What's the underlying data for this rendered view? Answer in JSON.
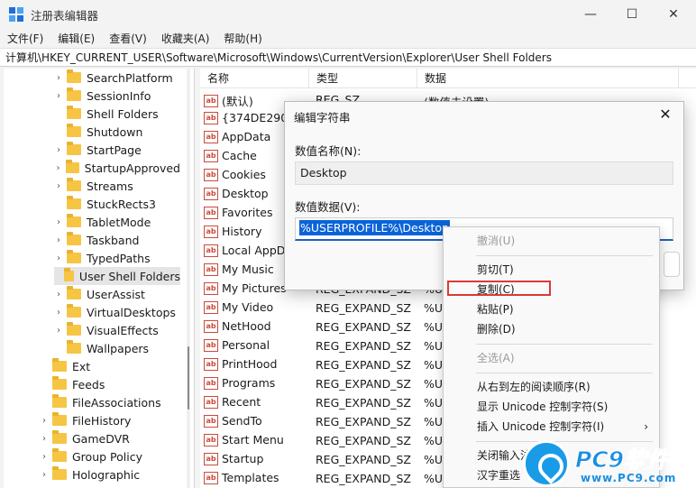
{
  "window": {
    "title": "注册表编辑器",
    "minimize": "—",
    "maximize": "☐",
    "close": "✕"
  },
  "menubar": [
    "文件(F)",
    "编辑(E)",
    "查看(V)",
    "收藏夹(A)",
    "帮助(H)"
  ],
  "address": "计算机\\HKEY_CURRENT_USER\\Software\\Microsoft\\Windows\\CurrentVersion\\Explorer\\User Shell Folders",
  "tree": [
    {
      "label": "SearchPlatform",
      "chevron": "›"
    },
    {
      "label": "SessionInfo",
      "chevron": "›"
    },
    {
      "label": "Shell Folders",
      "chevron": ""
    },
    {
      "label": "Shutdown",
      "chevron": ""
    },
    {
      "label": "StartPage",
      "chevron": "›"
    },
    {
      "label": "StartupApproved",
      "chevron": "›"
    },
    {
      "label": "Streams",
      "chevron": "›"
    },
    {
      "label": "StuckRects3",
      "chevron": ""
    },
    {
      "label": "TabletMode",
      "chevron": "›"
    },
    {
      "label": "Taskband",
      "chevron": "›"
    },
    {
      "label": "TypedPaths",
      "chevron": "›"
    },
    {
      "label": "User Shell Folders",
      "chevron": "",
      "selected": true
    },
    {
      "label": "UserAssist",
      "chevron": "›"
    },
    {
      "label": "VirtualDesktops",
      "chevron": "›"
    },
    {
      "label": "VisualEffects",
      "chevron": "›"
    },
    {
      "label": "Wallpapers",
      "chevron": ""
    },
    {
      "label": "Ext",
      "chevron": ""
    },
    {
      "label": "Feeds",
      "chevron": ""
    },
    {
      "label": "FileAssociations",
      "chevron": ""
    },
    {
      "label": "FileHistory",
      "chevron": "›"
    },
    {
      "label": "GameDVR",
      "chevron": "›"
    },
    {
      "label": "Group Policy",
      "chevron": "›"
    },
    {
      "label": "Holographic",
      "chevron": "›"
    }
  ],
  "columns": {
    "name": "名称",
    "type": "类型",
    "data": "数据"
  },
  "rows": [
    {
      "name": "(默认)",
      "type": "REG_SZ",
      "data": "(数值未设置)"
    },
    {
      "name": "{374DE290-",
      "type": "",
      "data": ""
    },
    {
      "name": "AppData",
      "type": "",
      "data": ""
    },
    {
      "name": "Cache",
      "type": "",
      "data": ""
    },
    {
      "name": "Cookies",
      "type": "",
      "data": ""
    },
    {
      "name": "Desktop",
      "type": "",
      "data": ""
    },
    {
      "name": "Favorites",
      "type": "",
      "data": ""
    },
    {
      "name": "History",
      "type": "",
      "data": ""
    },
    {
      "name": "Local AppD",
      "type": "",
      "data": ""
    },
    {
      "name": "My Music",
      "type": "",
      "data": ""
    },
    {
      "name": "My Pictures",
      "type": "REG_EXPAND_SZ",
      "data": "%U"
    },
    {
      "name": "My Video",
      "type": "REG_EXPAND_SZ",
      "data": "%U"
    },
    {
      "name": "NetHood",
      "type": "REG_EXPAND_SZ",
      "data": "%U"
    },
    {
      "name": "Personal",
      "type": "REG_EXPAND_SZ",
      "data": "%U"
    },
    {
      "name": "PrintHood",
      "type": "REG_EXPAND_SZ",
      "data": "%U"
    },
    {
      "name": "Programs",
      "type": "REG_EXPAND_SZ",
      "data": "%U"
    },
    {
      "name": "Recent",
      "type": "REG_EXPAND_SZ",
      "data": "%U"
    },
    {
      "name": "SendTo",
      "type": "REG_EXPAND_SZ",
      "data": "%U"
    },
    {
      "name": "Start Menu",
      "type": "REG_EXPAND_SZ",
      "data": "%U"
    },
    {
      "name": "Startup",
      "type": "REG_EXPAND_SZ",
      "data": "%U"
    },
    {
      "name": "Templates",
      "type": "REG_EXPAND_SZ",
      "data": "%U"
    }
  ],
  "dialog": {
    "title": "编辑字符串",
    "close": "✕",
    "name_label": "数值名称(N):",
    "name_value": "Desktop",
    "data_label": "数值数据(V):",
    "data_value": "%USERPROFILE%\\Desktop"
  },
  "context_menu": [
    {
      "label": "撤消(U)",
      "disabled": true
    },
    {
      "separator": true
    },
    {
      "label": "剪切(T)"
    },
    {
      "label": "复制(C)"
    },
    {
      "label": "粘贴(P)"
    },
    {
      "label": "删除(D)"
    },
    {
      "separator": true
    },
    {
      "label": "全选(A)",
      "disabled": true
    },
    {
      "separator": true
    },
    {
      "label": "从右到左的阅读顺序(R)"
    },
    {
      "label": "显示 Unicode 控制字符(S)"
    },
    {
      "label": "插入 Unicode 控制字符(I)",
      "submenu": "›"
    },
    {
      "separator": true
    },
    {
      "label": "关闭输入法"
    },
    {
      "label": "汉字重选"
    }
  ],
  "watermark": {
    "brand": "PC9软件园",
    "url": "www.PC9.com"
  }
}
